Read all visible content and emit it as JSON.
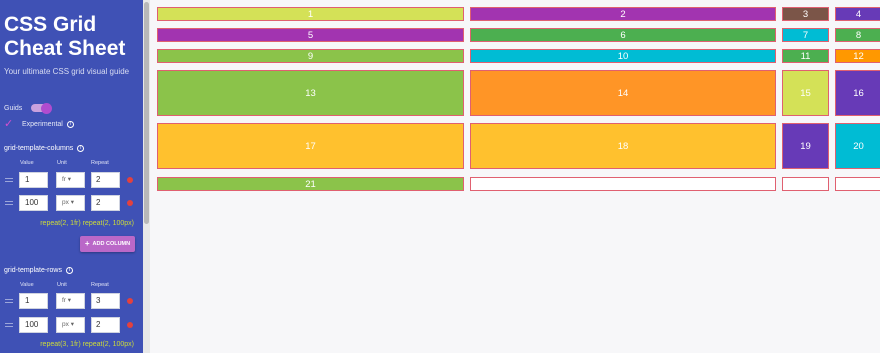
{
  "sidebar": {
    "title_line1": "CSS Grid",
    "title_line2": "Cheat Sheet",
    "subtitle": "Your ultimate CSS grid visual guide",
    "guides_label": "Guids",
    "experimental_label": "Experimental",
    "columns": {
      "label": "grid-template-columns",
      "headers": {
        "value": "Value",
        "unit": "Unit",
        "repeat": "Repeat"
      },
      "rows": [
        {
          "value": "1",
          "unit": "fr",
          "repeat": "2"
        },
        {
          "value": "100",
          "unit": "px",
          "repeat": "2"
        }
      ],
      "summary": "repeat(2, 1fr) repeat(2, 100px)",
      "add_label": "ADD COLUMN"
    },
    "rows_section": {
      "label": "grid-template-rows",
      "headers": {
        "value": "Value",
        "unit": "Unit",
        "repeat": "Repeat"
      },
      "rows": [
        {
          "value": "1",
          "unit": "fr",
          "repeat": "3"
        },
        {
          "value": "100",
          "unit": "px",
          "repeat": "2"
        }
      ],
      "summary": "repeat(3, 1fr) repeat(2, 100px)"
    }
  },
  "grid": {
    "cells": [
      {
        "label": "1",
        "color": "#d4e157"
      },
      {
        "label": "2",
        "color": "#a234b0"
      },
      {
        "label": "3",
        "color": "#7b5548"
      },
      {
        "label": "4",
        "color": "#673ab7"
      },
      {
        "label": "5",
        "color": "#a234b0"
      },
      {
        "label": "6",
        "color": "#4caf50"
      },
      {
        "label": "7",
        "color": "#00bcd4"
      },
      {
        "label": "8",
        "color": "#4caf50"
      },
      {
        "label": "9",
        "color": "#8bc34a"
      },
      {
        "label": "10",
        "color": "#00bcd4"
      },
      {
        "label": "11",
        "color": "#4caf50"
      },
      {
        "label": "12",
        "color": "#ff9800"
      },
      {
        "label": "13",
        "color": "#8bc34a"
      },
      {
        "label": "14",
        "color": "#ff9526"
      },
      {
        "label": "15",
        "color": "#d4e157"
      },
      {
        "label": "16",
        "color": "#673ab7"
      },
      {
        "label": "17",
        "color": "#ffc12e"
      },
      {
        "label": "18",
        "color": "#ffc12e"
      },
      {
        "label": "19",
        "color": "#673ab7"
      },
      {
        "label": "20",
        "color": "#00bcd4"
      },
      {
        "label": "21",
        "color": "#8bc34a"
      }
    ],
    "empty_color": "#ffffff"
  }
}
